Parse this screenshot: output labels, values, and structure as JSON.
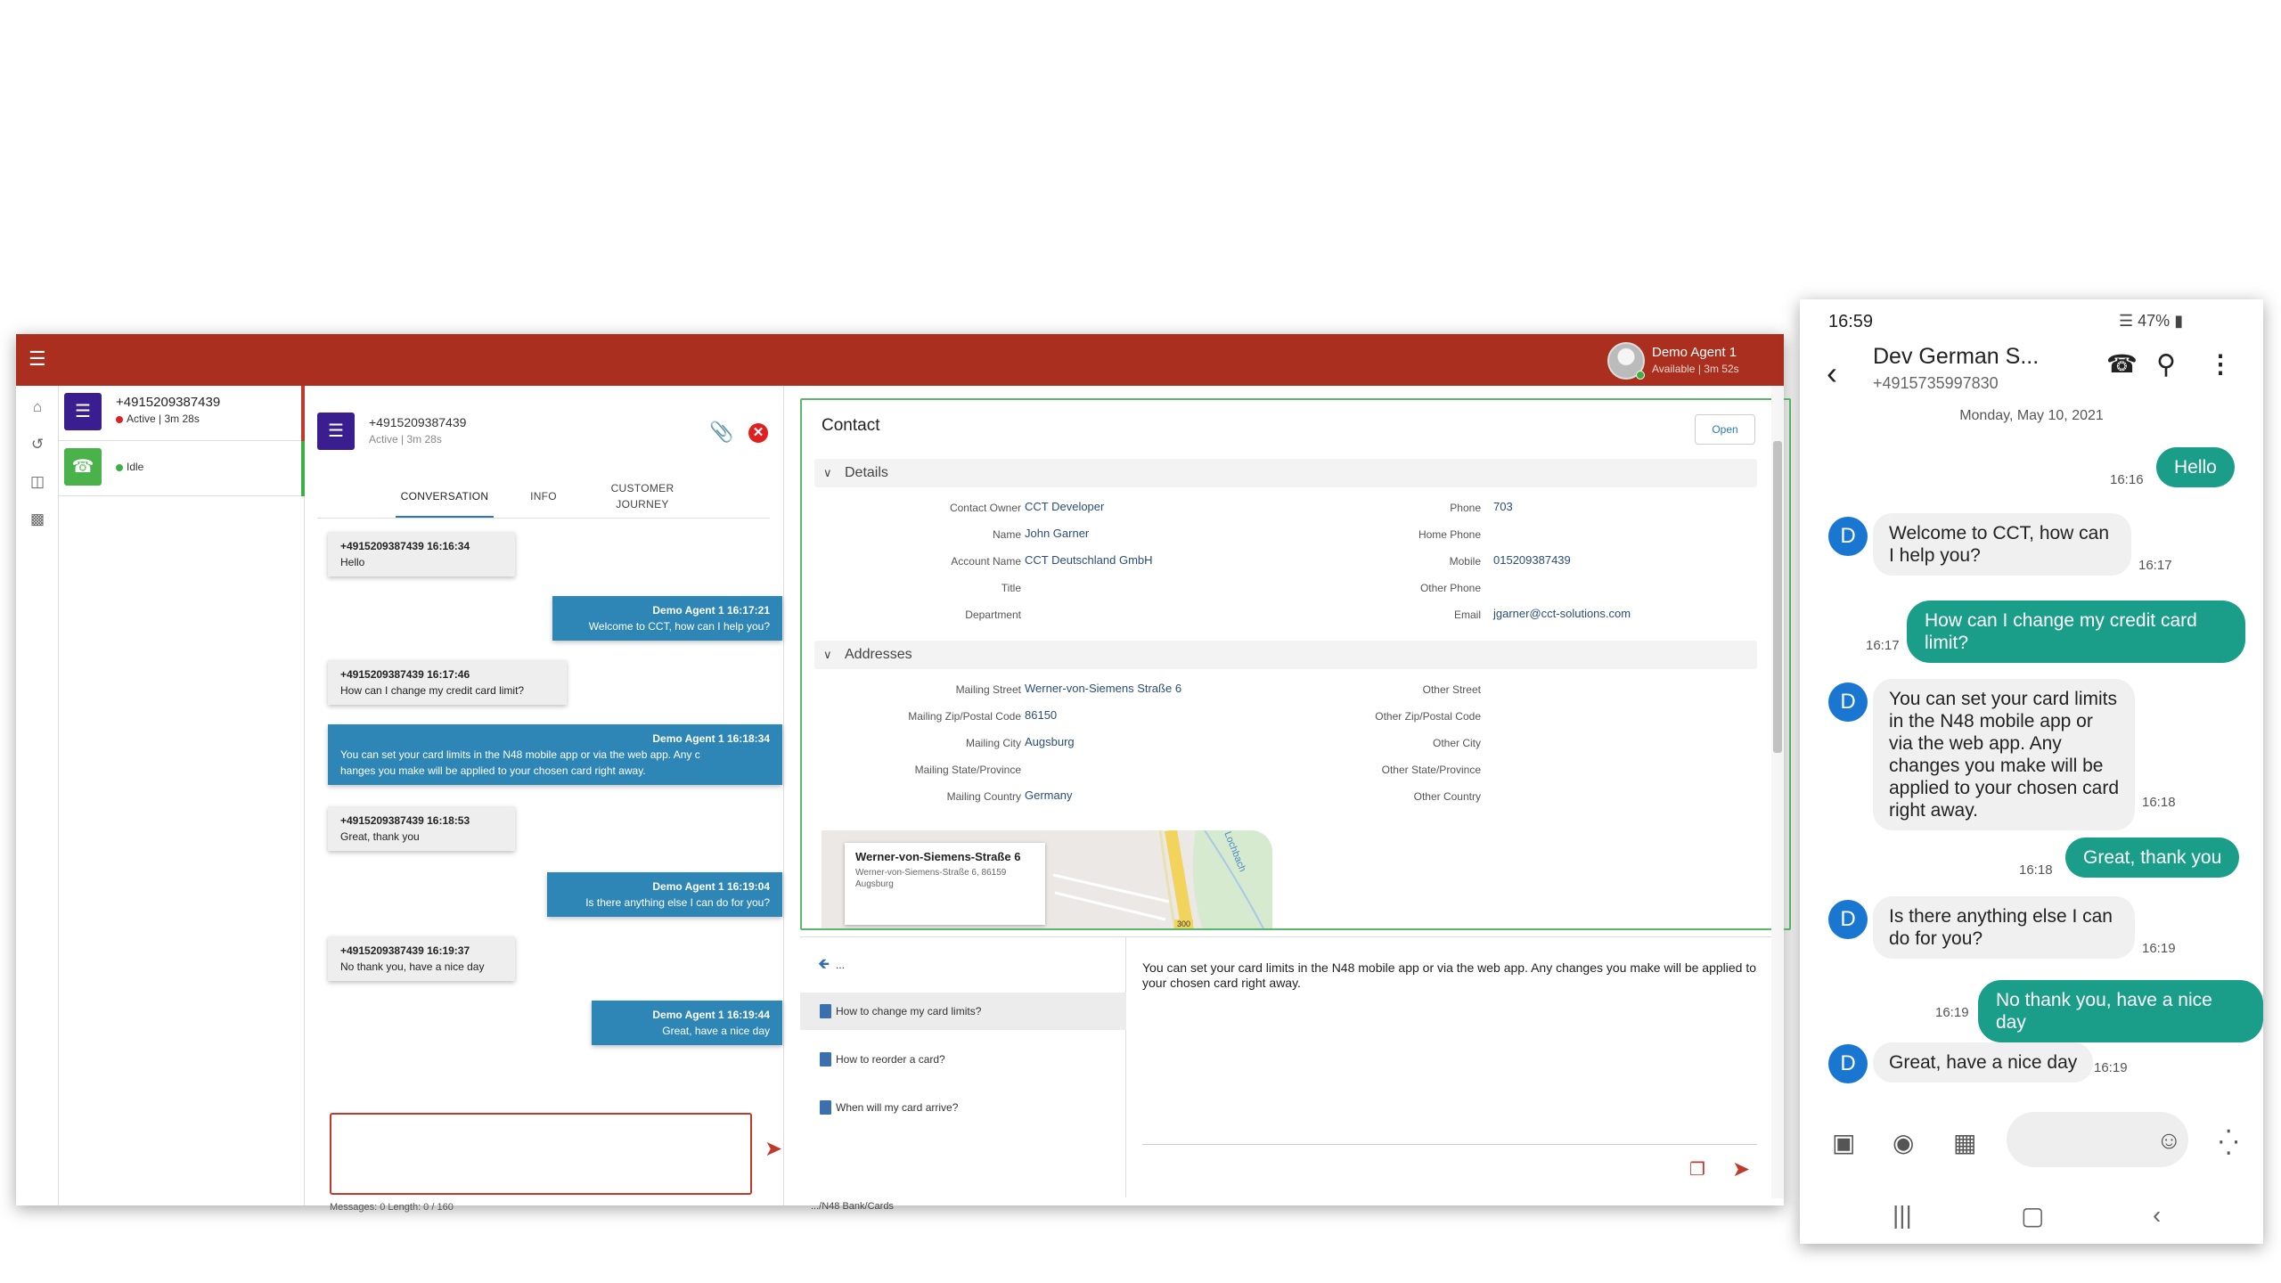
{
  "agent_app": {
    "agent": {
      "name": "Demo Agent 1",
      "status": "Available | 3m 52s"
    },
    "sessions": [
      {
        "title": "+4915209387439",
        "status": "Active | 3m 28s"
      },
      {
        "status": "Idle"
      }
    ],
    "conversation": {
      "number": "+4915209387439",
      "state": "Active | 3m 28s",
      "tabs": [
        "CONVERSATION",
        "INFO",
        "CUSTOMER",
        "JOURNEY"
      ],
      "messages": [
        {
          "from": "+4915209387439 16:16:34",
          "text": "Hello"
        },
        {
          "from": "Demo Agent 1 16:17:21",
          "text": "Welcome to CCT, how can I help you?"
        },
        {
          "from": "+4915209387439 16:17:46",
          "text": "How can I change my credit card limit?"
        },
        {
          "from": "Demo Agent 1 16:18:34",
          "text": "You can set your card limits in the N48 mobile app or via the web app. Any c",
          "text2": "hanges you make will be applied to your chosen card right away."
        },
        {
          "from": "+4915209387439 16:18:53",
          "text": "Great, thank you"
        },
        {
          "from": "Demo Agent 1 16:19:04",
          "text": "Is there anything else I can do for you?"
        },
        {
          "from": "+4915209387439 16:19:37",
          "text": "No thank you, have a nice day"
        },
        {
          "from": "Demo Agent 1 16:19:44",
          "text": "Great, have a nice day"
        }
      ],
      "counter": "Messages: 0 Length: 0 / 160"
    },
    "contact": {
      "title": "Contact",
      "open_label": "Open",
      "details_label": "Details",
      "addresses_label": "Addresses",
      "fields_left": [
        {
          "label": "Contact Owner",
          "value": "CCT Developer"
        },
        {
          "label": "Name",
          "value": "John Garner"
        },
        {
          "label": "Account Name",
          "value": "CCT Deutschland GmbH"
        },
        {
          "label": "Title",
          "value": ""
        },
        {
          "label": "Department",
          "value": ""
        }
      ],
      "fields_right": [
        {
          "label": "Phone",
          "value": "703"
        },
        {
          "label": "Home Phone",
          "value": ""
        },
        {
          "label": "Mobile",
          "value": "015209387439"
        },
        {
          "label": "Other Phone",
          "value": ""
        },
        {
          "label": "Email",
          "value": "jgarner@cct-solutions.com"
        }
      ],
      "addr_left": [
        {
          "label": "Mailing Street",
          "value": "Werner-von-Siemens Straße 6"
        },
        {
          "label": "Mailing Zip/Postal Code",
          "value": "86150"
        },
        {
          "label": "Mailing City",
          "value": "Augsburg"
        },
        {
          "label": "Mailing State/Province",
          "value": ""
        },
        {
          "label": "Mailing Country",
          "value": "Germany"
        }
      ],
      "addr_right": [
        {
          "label": "Other Street"
        },
        {
          "label": "Other Zip/Postal Code"
        },
        {
          "label": "Other City"
        },
        {
          "label": "Other State/Province"
        },
        {
          "label": "Other Country"
        }
      ],
      "map": {
        "title": "Werner-von-Siemens-Straße 6",
        "line1": "Werner-von-Siemens-Straße 6, 86159",
        "line2": "Augsburg",
        "road_label": "300",
        "river_label": "Lochbach"
      }
    },
    "kb": {
      "back_label": "...",
      "items": [
        "How to change my card limits?",
        "How to reorder a card?",
        "When will my card arrive?"
      ],
      "text": "You can set your card limits in the N48 mobile app or via the web app. Any changes you make will be applied to your chosen card right away.",
      "path": ".../N48 Bank/Cards"
    }
  },
  "phone": {
    "time": "16:59",
    "battery": "47%",
    "contact_name": "Dev German S...",
    "contact_number": "+4915735997830",
    "date": "Monday, May 10, 2021",
    "avatar_letter": "D",
    "messages": [
      {
        "dir": "out",
        "text": "Hello",
        "time": "16:16"
      },
      {
        "dir": "in",
        "text": "Welcome to CCT, how can I help you?",
        "time": "16:17"
      },
      {
        "dir": "out",
        "text": "How can I change my credit card limit?",
        "time": "16:17"
      },
      {
        "dir": "in",
        "text": "You can set your card limits in the N48 mobile app or via the web app. Any changes you make will be applied to your chosen card right away.",
        "time": "16:18"
      },
      {
        "dir": "out",
        "text": "Great, thank you",
        "time": "16:18"
      },
      {
        "dir": "in",
        "text": "Is there anything else I can do for you?",
        "time": "16:19"
      },
      {
        "dir": "out",
        "text": "No thank you, have a nice day",
        "time": "16:19"
      },
      {
        "dir": "in",
        "text": "Great, have a nice day",
        "time": "16:19"
      }
    ]
  }
}
